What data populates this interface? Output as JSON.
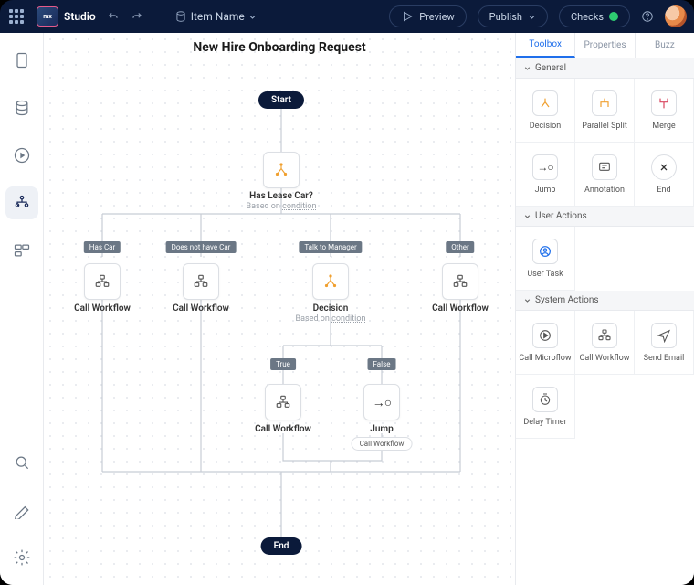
{
  "header": {
    "logo_text": "mx",
    "studio": "Studio",
    "item_label": "Item Name",
    "preview": "Preview",
    "publish": "Publish",
    "checks": "Checks"
  },
  "workflow": {
    "title": "New Hire Onboarding Request",
    "start": "Start",
    "end": "End",
    "lease_q": "Has Lease Car?",
    "based_on": "Based on",
    "cond_word": "condition",
    "branches": {
      "has_car": "Has Car",
      "no_car": "Does not have Car",
      "talk_mgr": "Talk to Manager",
      "other": "Other",
      "true": "True",
      "false": "False"
    },
    "call_wf": "Call Workflow",
    "decision": "Decision",
    "jump": "Jump",
    "jump_target": "Call Workflow"
  },
  "panel": {
    "tabs": {
      "toolbox": "Toolbox",
      "properties": "Properties",
      "buzz": "Buzz"
    },
    "sections": {
      "general": "General",
      "user_actions": "User Actions",
      "system_actions": "System Actions"
    },
    "tools": {
      "decision": "Decision",
      "parallel_split": "Parallel Split",
      "merge": "Merge",
      "jump": "Jump",
      "annotation": "Annotation",
      "end": "End",
      "user_task": "User Task",
      "call_microflow": "Call Microflow",
      "call_workflow": "Call Workflow",
      "send_email": "Send Email",
      "delay_timer": "Delay Timer"
    }
  }
}
